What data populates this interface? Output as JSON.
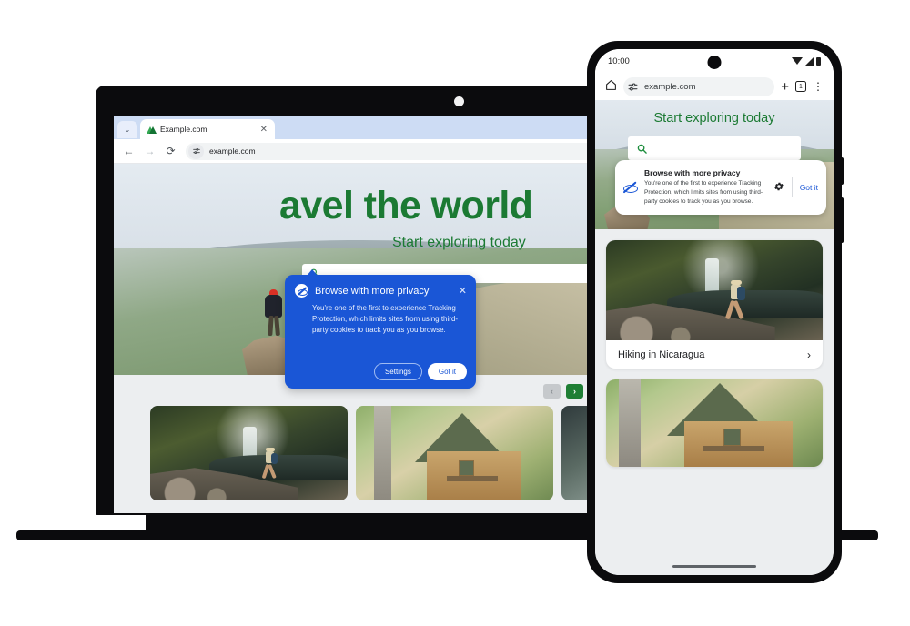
{
  "desktop": {
    "browser": {
      "tab": {
        "title": "Example.com",
        "close_label": "✕",
        "chevron": "⌄",
        "favicon": "site-favicon"
      },
      "back_icon": "←",
      "forward_icon": "→",
      "reload_icon": "⟳",
      "omnibox": {
        "url": "example.com",
        "tune_icon": "site-settings-icon"
      }
    },
    "page": {
      "hero_heading": "avel the world",
      "hero_subheading": "Start exploring today",
      "search_placeholder": "",
      "search_icon": "search-icon",
      "carousel": {
        "prev_label": "‹",
        "next_label": "›"
      }
    },
    "dialog": {
      "icon": "eye-slash-icon",
      "title": "Browse with more privacy",
      "close_label": "✕",
      "body": "You're one of the first to experience Tracking Protection, which limits sites from using third-party cookies to track you as you browse.",
      "settings_label": "Settings",
      "got_it_label": "Got it",
      "background_color": "#1a56d6"
    }
  },
  "phone": {
    "status_bar": {
      "time": "10:00",
      "icons": [
        "wifi-icon",
        "signal-icon",
        "battery-icon"
      ]
    },
    "toolbar": {
      "home_icon": "⌂",
      "tune_icon": "site-settings-icon",
      "url": "example.com",
      "new_tab_label": "+",
      "tab_count": "1",
      "menu_icon": "⋮"
    },
    "dialog": {
      "icon": "eye-slash-icon",
      "title": "Browse with more privacy",
      "body": "You're one of the first to experience Tracking Protection, which limits sites from using third-party cookies to track you as you browse.",
      "gear_icon": "⚙",
      "got_it_label": "Got it",
      "accent_color": "#1a56d6"
    },
    "page": {
      "title": "Start exploring today",
      "search_icon": "search-icon",
      "search_placeholder": "",
      "cards": [
        {
          "caption": "Hiking in Nicaragua",
          "chevron": "›",
          "image": "waterfall-hiker"
        },
        {
          "caption": "",
          "chevron": "",
          "image": "a-frame-cabin"
        }
      ]
    }
  },
  "theme": {
    "brand_green": "#1b7a33",
    "brand_blue": "#1a56d6",
    "page_background": "#eceef0"
  }
}
